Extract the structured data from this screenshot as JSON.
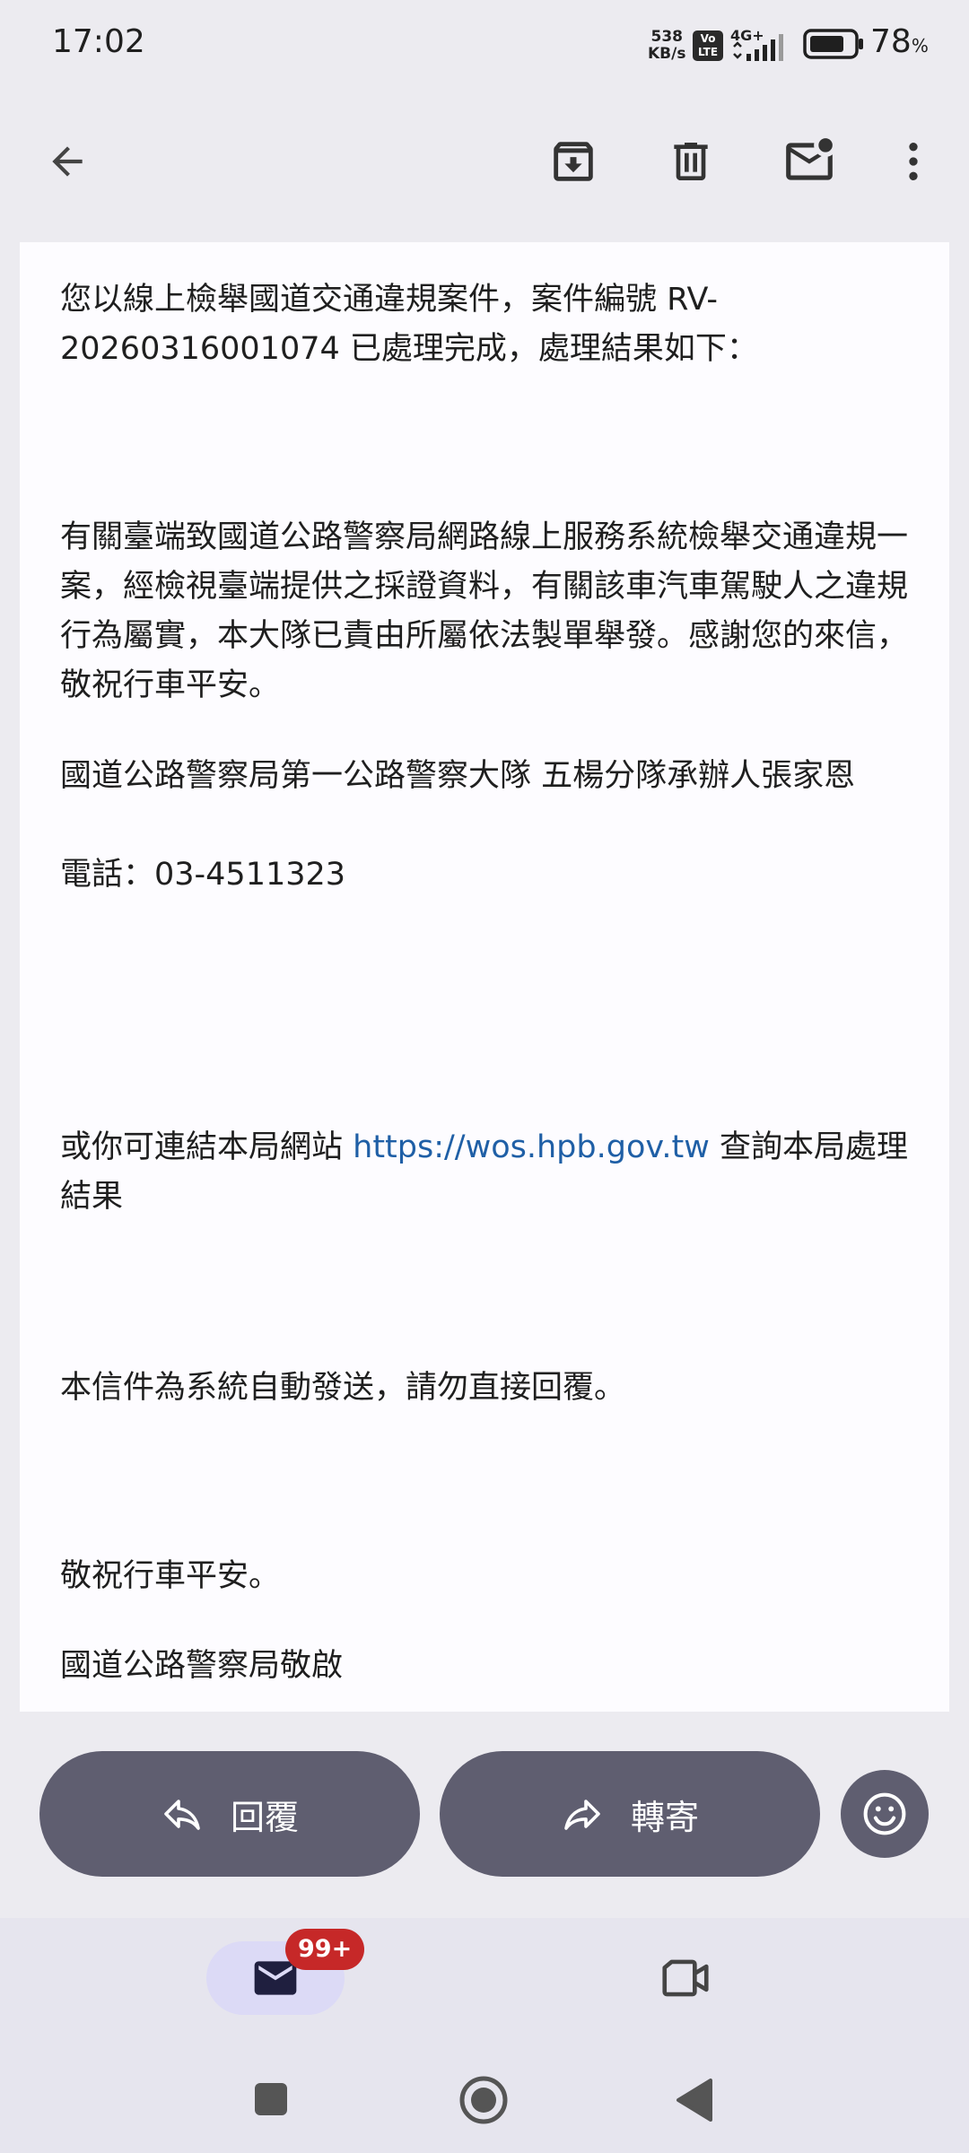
{
  "status_bar": {
    "time": "17:02",
    "net_speed_value": "538",
    "net_speed_unit": "KB/s",
    "volte_top": "Vo",
    "volte_bottom": "LTE",
    "network": "4G+",
    "battery_percent": "78",
    "battery_symbol": "%"
  },
  "toolbar": {
    "icons": [
      "back-arrow-icon",
      "archive-icon",
      "delete-icon",
      "mark-unread-icon",
      "more-vert-icon"
    ]
  },
  "message": {
    "para1": "您以線上檢舉國道交通違規案件，案件編號 RV-20260316001074 已處理完成，處理結果如下：",
    "para2": "有關臺端致國道公路警察局網路線上服務系統檢舉交通違規一案，經檢視臺端提供之採證資料，有關該車汽車駕駛人之違規行為屬實，本大隊已責由所屬依法製單舉發。感謝您的來信，敬祝行車平安。",
    "signer": "國道公路警察局第一公路警察大隊 五楊分隊承辦人張家恩",
    "phone": "電話：03-4511323",
    "link_prefix": "或你可連結本局網站 ",
    "link_url": "https://wos.hpb.gov.tw",
    "link_suffix": " 查詢本局處理結果",
    "auto_notice": "本信件為系統自動發送，請勿直接回覆。",
    "closing": "敬祝行車平安。",
    "sign_off": "國道公路警察局敬啟"
  },
  "actions": {
    "reply_label": "回覆",
    "forward_label": "轉寄"
  },
  "bottom_nav": {
    "mail_badge": "99+"
  },
  "colors": {
    "accent_pill": "#5f5e70",
    "link": "#1f5fa6",
    "badge": "#c62828"
  }
}
